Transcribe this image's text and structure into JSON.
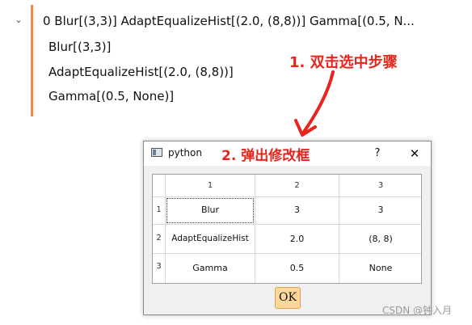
{
  "tree": {
    "root_label": "0 Blur[(3,3)] AdaptEqualizeHist[(2.0, (8,8))] Gamma[(0.5, N...",
    "children": [
      "Blur[(3,3)]",
      "AdaptEqualizeHist[(2.0, (8,8))]",
      "Gamma[(0.5, None)]"
    ]
  },
  "annotations": {
    "step1": "1. 双击选中步骤",
    "step2": "2. 弹出修改框"
  },
  "dialog": {
    "title": "python",
    "help": "?",
    "close": "✕",
    "table": {
      "columns": [
        "1",
        "2",
        "3"
      ],
      "row_headers": [
        "1",
        "2",
        "3"
      ],
      "rows": [
        [
          "Blur",
          "3",
          "3"
        ],
        [
          "AdaptEqualizeHist",
          "2.0",
          "(8, 8)"
        ],
        [
          "Gamma",
          "0.5",
          "None"
        ]
      ]
    },
    "ok_label": "OK"
  },
  "watermark": "CSDN @钟入月",
  "colors": {
    "accent": "#f0893c",
    "annotation": "#e8241c",
    "ok_button": "#ffd79a"
  }
}
